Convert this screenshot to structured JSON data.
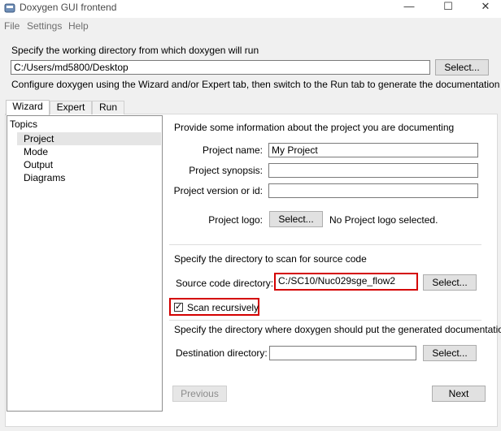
{
  "window": {
    "title": "Doxygen GUI frontend",
    "minimize_glyph": "—",
    "maximize_glyph": "☐",
    "close_glyph": "✕"
  },
  "menu": [
    "File",
    "Settings",
    "Help"
  ],
  "workdir": {
    "label": "Specify the working directory from which doxygen will run",
    "value": "C:/Users/md5800/Desktop",
    "select_label": "Select..."
  },
  "configure_text": "Configure doxygen using the Wizard and/or Expert tab, then switch to the Run tab to generate the documentation",
  "tabs": [
    {
      "label": "Wizard",
      "active": true
    },
    {
      "label": "Expert",
      "active": false
    },
    {
      "label": "Run",
      "active": false
    }
  ],
  "topics": {
    "header": "Topics",
    "items": [
      {
        "label": "Project",
        "selected": true
      },
      {
        "label": "Mode",
        "selected": false
      },
      {
        "label": "Output",
        "selected": false
      },
      {
        "label": "Diagrams",
        "selected": false
      }
    ]
  },
  "project": {
    "heading": "Provide some information about the project you are documenting",
    "name_label": "Project name:",
    "name_value": "My Project",
    "synopsis_label": "Project synopsis:",
    "synopsis_value": "",
    "version_label": "Project version or id:",
    "version_value": "",
    "logo_label": "Project logo:",
    "logo_button": "Select...",
    "logo_status": "No Project logo selected."
  },
  "source": {
    "heading": "Specify the directory to scan for source code",
    "dir_label": "Source code directory:",
    "dir_value": "C:/SC10/Nuc029sge_flow2",
    "select_label": "Select...",
    "recursive_label": "Scan recursively",
    "recursive_checked": true,
    "check_glyph": "✓"
  },
  "destination": {
    "heading": "Specify the directory where doxygen should put the generated documentation",
    "dir_label": "Destination directory:",
    "dir_value": "",
    "select_label": "Select..."
  },
  "nav": {
    "previous_label": "Previous",
    "next_label": "Next"
  },
  "colors": {
    "highlight": "#d40000",
    "selected_topic": "#e5e5e5"
  }
}
